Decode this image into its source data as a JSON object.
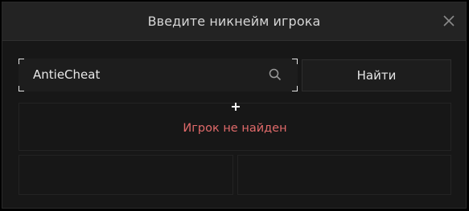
{
  "dialog": {
    "title": "Введите никнейм игрока",
    "close_icon": "close-icon"
  },
  "search": {
    "value": "AntieCheat",
    "icon": "search-icon"
  },
  "find_button": {
    "label": "Найти"
  },
  "result": {
    "message": "Игрок не найден",
    "message_color": "#e06a6a"
  },
  "colors": {
    "background": "#171717",
    "header": "#232323",
    "text": "#d6d6d6"
  }
}
